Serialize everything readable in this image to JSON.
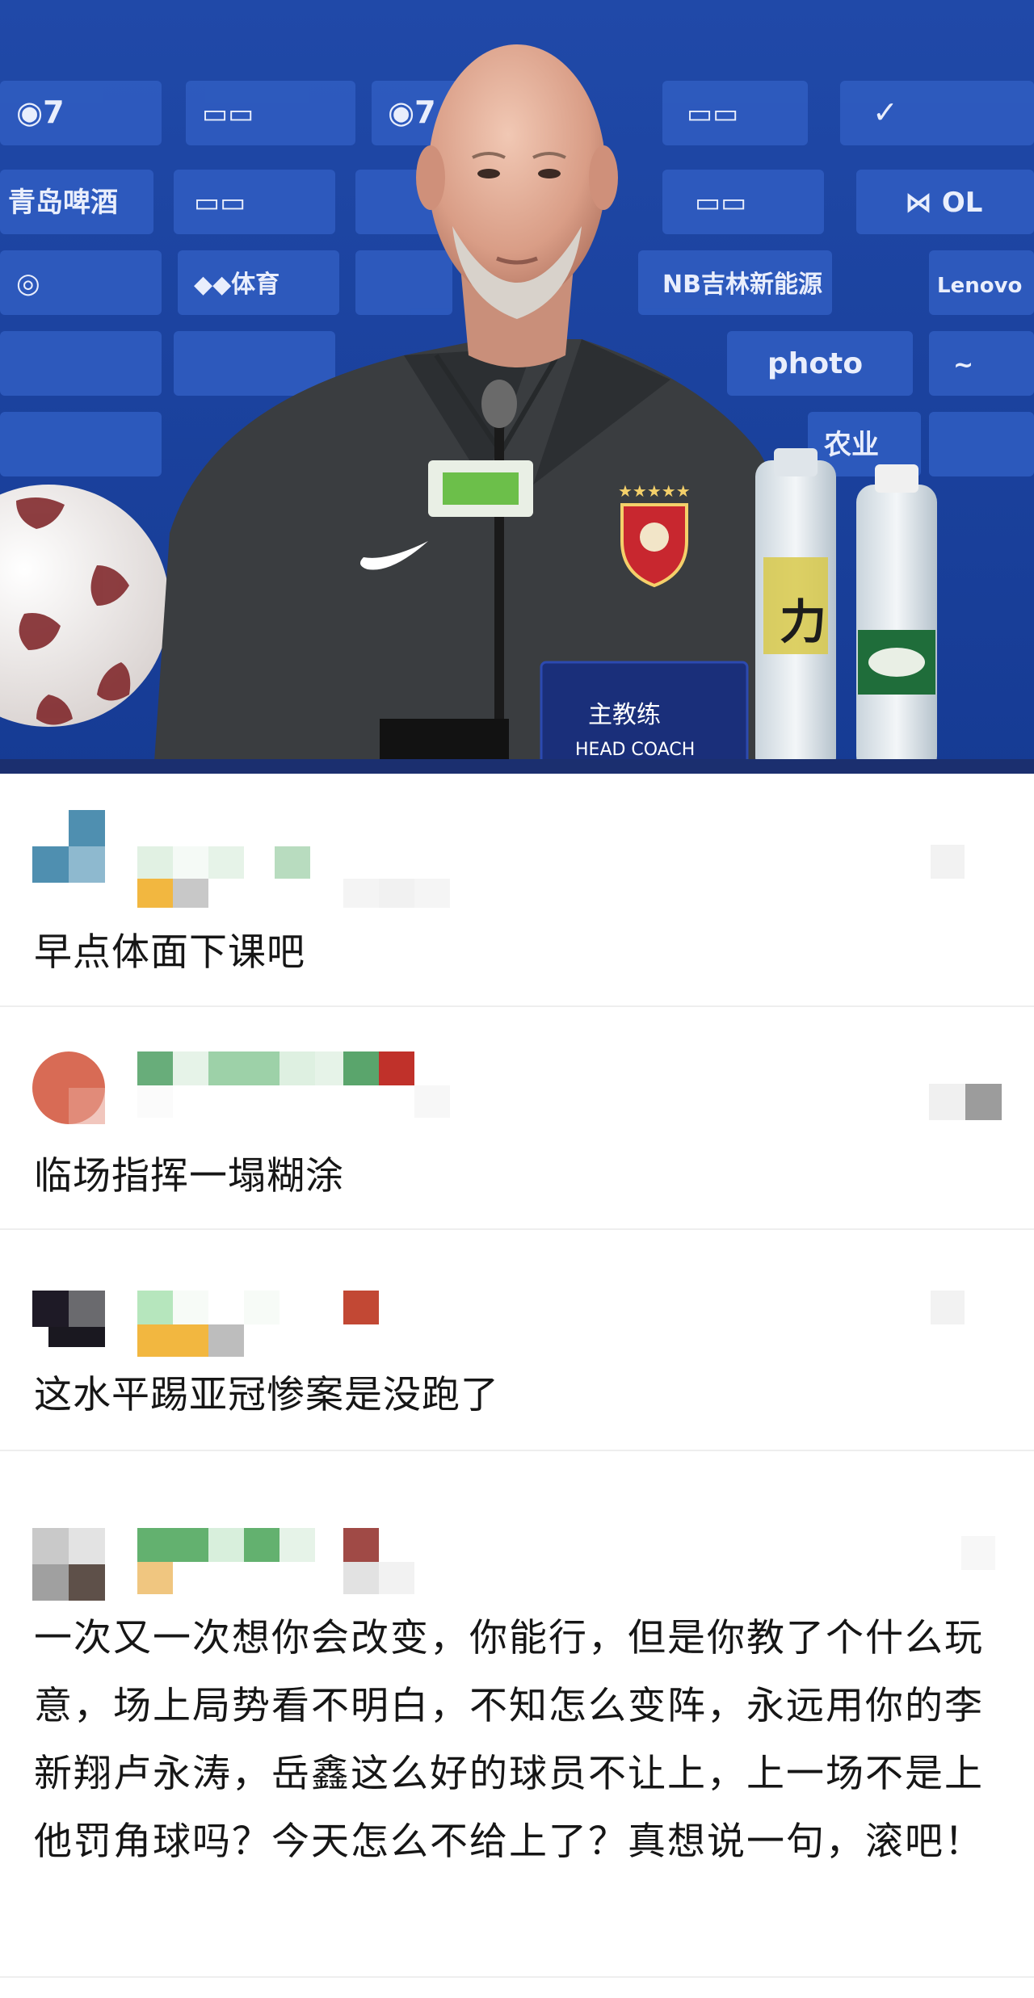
{
  "photo": {
    "nameplate_title": "主教练",
    "nameplate_subtitle": "HEAD COACH",
    "bottle_label": "力",
    "sponsor_labels": [
      "青岛啤酒",
      "photo",
      "Lenovo",
      "NB吉林新能源",
      "农业"
    ]
  },
  "comments": [
    {
      "text": "早点体面下课吧"
    },
    {
      "text": "临场指挥一塌糊涂"
    },
    {
      "text": "这水平踢亚冠惨案是没跑了"
    },
    {
      "text": "一次又一次想你会改变，你能行，但是你教了个什么玩意，场上局势看不明白，不知怎么变阵，永远用你的李新翔卢永涛，岳鑫这么好的球员不让上，上一场不是上他罚角球吗？今天怎么不给上了？真想说一句，滚吧！"
    }
  ],
  "colors": {
    "backdrop": "#1d3f9c",
    "shirt": "#3a3d40",
    "text": "#161616",
    "divider": "#eeeeee"
  }
}
